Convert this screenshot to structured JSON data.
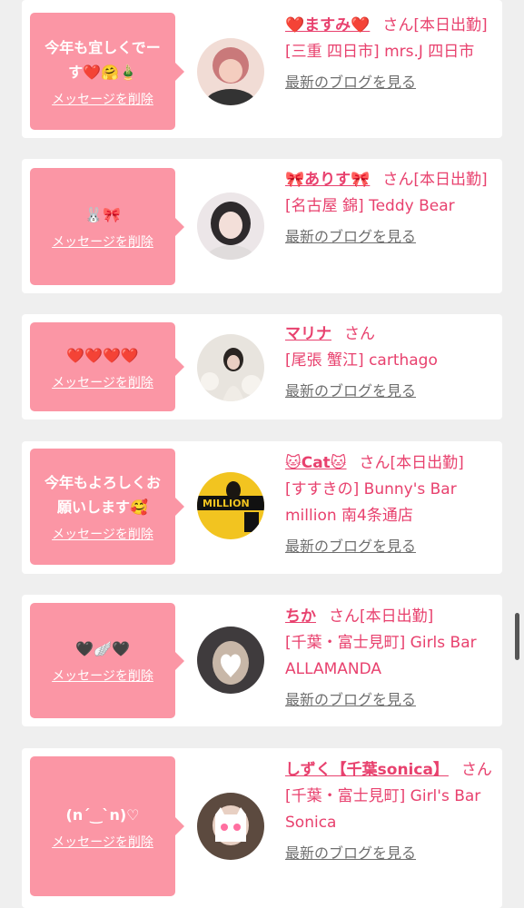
{
  "delete_label": "メッセージを削除",
  "blog_label": "最新のブログを見る",
  "san": "さん",
  "cards": [
    {
      "message": "今年も宜しくでー\nす❤️🤗🎍",
      "name": "❤️ますみ❤️",
      "status": "[本日出勤]",
      "shop": "[三重 四日市] mrs.J 四日市",
      "avatar_colors": [
        "#e9c9c2",
        "#c9797a"
      ]
    },
    {
      "message": "🐰🎀",
      "name": "🎀ありす🎀",
      "status": "[本日出勤]",
      "shop": "[名古屋 錦] Teddy Bear",
      "avatar_colors": [
        "#e8dfe2",
        "#b4a6ad"
      ]
    },
    {
      "message": "❤️❤️❤️❤️",
      "name": "マリナ",
      "status": "",
      "shop": "[尾張 蟹江] carthago",
      "avatar_colors": [
        "#e6e2dc",
        "#a79a8c"
      ]
    },
    {
      "message": "今年もよろしくお\n願いします🥰",
      "name": "🐱Cat🐱",
      "status": "[本日出勤]",
      "shop": "[すすきの] Bunny's Bar million 南4条通店",
      "avatar_colors": [
        "#f2c420",
        "#3a2c1c"
      ]
    },
    {
      "message": "🖤🪽🖤",
      "name": "ちか",
      "status": "[本日出勤]",
      "shop": "[千葉・富士見町] Girls Bar ALLAMANDA",
      "avatar_colors": [
        "#4e4a4c",
        "#c8b7a8"
      ]
    },
    {
      "message": "(n´‿`n)♡",
      "name": "しずく【千葉sonica】",
      "status": "",
      "shop": "[千葉・富士見町] Girl's Bar Sonica",
      "avatar_colors": [
        "#5c4a3f",
        "#e8d0c3"
      ]
    }
  ]
}
